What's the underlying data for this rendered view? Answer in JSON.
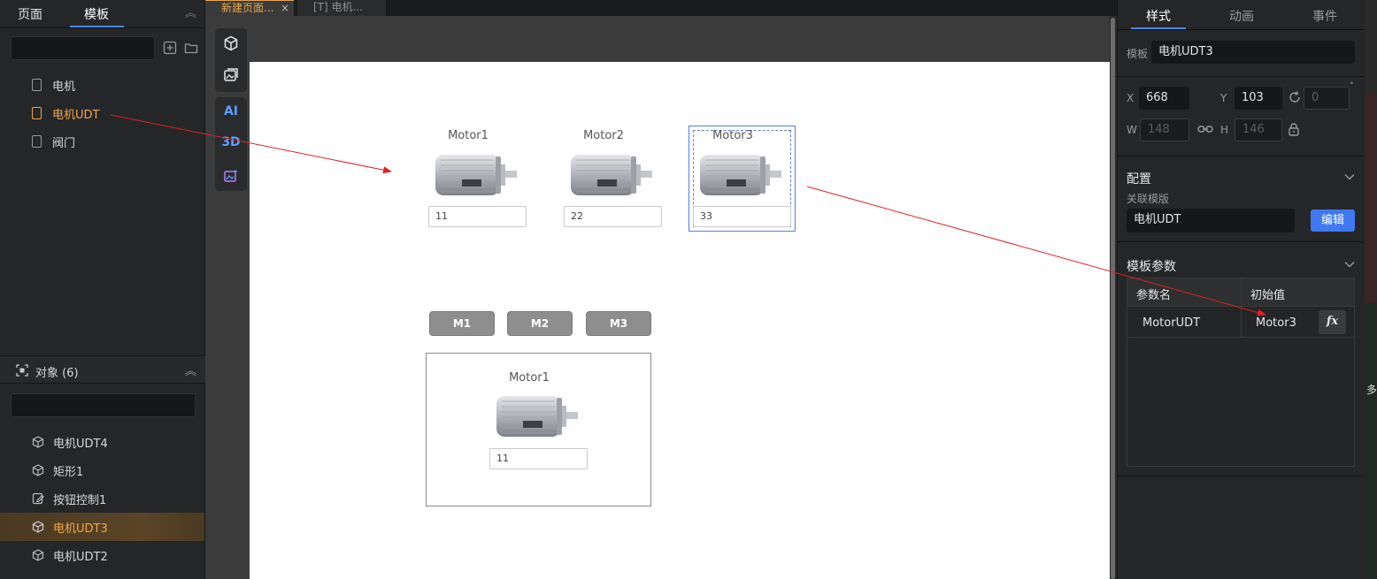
{
  "left_panel": {
    "tabs": [
      {
        "label": "页面"
      },
      {
        "label": "模板"
      }
    ],
    "templates": [
      {
        "label": "电机"
      },
      {
        "label": "电机UDT"
      },
      {
        "label": "阀门"
      }
    ],
    "objects_header": "对象 (6)",
    "objects": [
      {
        "label": "电机UDT4"
      },
      {
        "label": "矩形1"
      },
      {
        "label": "按钮控制1"
      },
      {
        "label": "电机UDT3"
      },
      {
        "label": "电机UDT2"
      }
    ]
  },
  "doc_tabs": [
    {
      "label": "新建页面..."
    },
    {
      "label": "[T] 电机..."
    }
  ],
  "canvas": {
    "motors": [
      {
        "label": "Motor1",
        "value": "11"
      },
      {
        "label": "Motor2",
        "value": "22"
      },
      {
        "label": "Motor3",
        "value": "33"
      }
    ],
    "buttons": [
      {
        "label": "M1"
      },
      {
        "label": "M2"
      },
      {
        "label": "M3"
      }
    ],
    "detail": {
      "label": "Motor1",
      "value": "11"
    }
  },
  "right_panel": {
    "tabs": [
      {
        "label": "样式"
      },
      {
        "label": "动画"
      },
      {
        "label": "事件"
      }
    ],
    "template_label": "模板",
    "template_value": "电机UDT3",
    "x_label": "X",
    "x_value": "668",
    "y_label": "Y",
    "y_value": "103",
    "rotation_value": "0",
    "w_label": "W",
    "w_value": "148",
    "h_label": "H",
    "h_value": "146",
    "config_title": "配置",
    "linked_template_label": "关联模版",
    "linked_template_value": "电机UDT",
    "edit_button": "编辑",
    "params_title": "模板参数",
    "params_headers": [
      "参数名",
      "初始值"
    ],
    "params_rows": [
      {
        "name": "MotorUDT",
        "value": "Motor3"
      }
    ]
  },
  "far_right_text": "多",
  "colors": {
    "accent": "#4b86ff",
    "selected_orange": "#f2a74a",
    "edit_button": "#3f78f0"
  }
}
